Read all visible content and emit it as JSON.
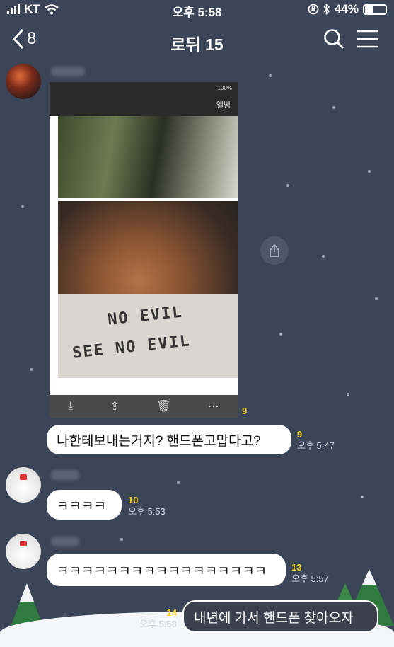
{
  "status_bar": {
    "carrier": "KT",
    "time": "오후 5:58",
    "battery": "44%",
    "battery_level": 0.44
  },
  "header": {
    "back_count": "8",
    "title": "로뒤 15"
  },
  "messages": [
    {
      "type": "image",
      "read_count": "9",
      "shirt_text": [
        "NO EVIL",
        "SEE NO EVIL"
      ],
      "photo_album_label": "앨범",
      "photo_status": "100%"
    },
    {
      "type": "text",
      "text": "나한테보내는거지? 핸드폰고맙다고?",
      "read_count": "9",
      "time": "오후 5:47"
    },
    {
      "type": "text",
      "text": "ㅋㅋㅋㅋ",
      "read_count": "10",
      "time": "오후 5:53"
    },
    {
      "type": "text",
      "text": "ㅋㅋㅋㅋㅋㅋㅋㅋㅋㅋㅋㅋㅋㅋㅋㅋㅋ",
      "read_count": "13",
      "time": "오후 5:57"
    },
    {
      "type": "text",
      "mine": true,
      "text": "내년에 가서 핸드폰 찾아오자",
      "read_count": "14",
      "time": "오후 5:58"
    }
  ],
  "colors": {
    "background": "#3a4558",
    "read_count": "#f2d321",
    "bubble": "#ffffff"
  }
}
